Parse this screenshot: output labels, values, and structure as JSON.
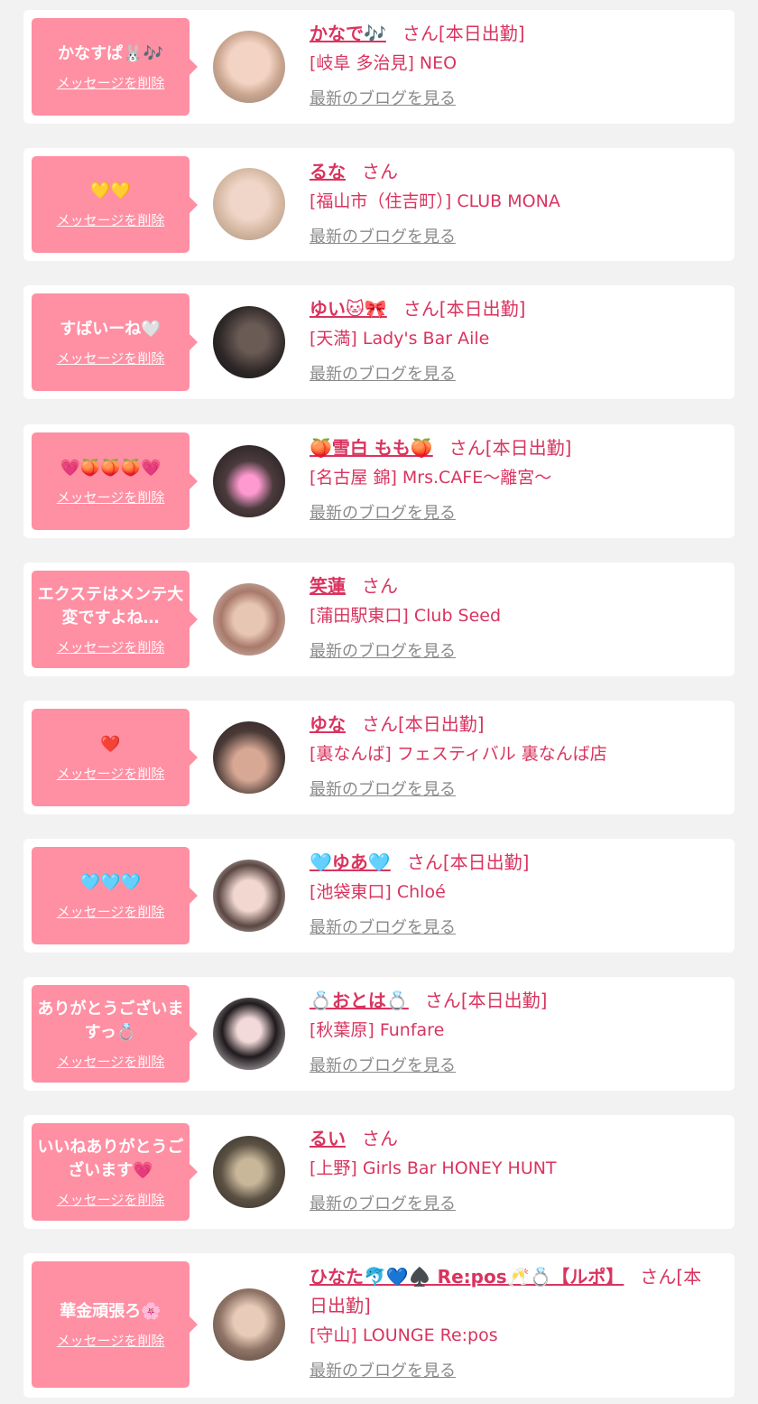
{
  "colors": {
    "accent": "#d9345f",
    "bubble": "#ff8fa3",
    "background": "#f2f2f2",
    "blog_link": "#8a8a8a"
  },
  "labels": {
    "san": "さん",
    "delete": "メッセージを削除",
    "blog": "最新のブログを見る"
  },
  "entries": [
    {
      "message": "かなすぱ🐰🎶",
      "name": "かなで🎶",
      "status": "[本日出勤]",
      "shop": "[岐阜 多治見] NEO"
    },
    {
      "message": "💛💛",
      "name": "るな",
      "status": "",
      "shop": "[福山市（住吉町）] CLUB MONA"
    },
    {
      "message": "すばいーね🤍",
      "name": "ゆい🐱🎀",
      "status": "[本日出勤]",
      "shop": "[天満] Lady's Bar Aile"
    },
    {
      "message": "💗🍑🍑🍑💗",
      "name": "🍑雪白 もも🍑",
      "status": "[本日出勤]",
      "shop": "[名古屋 錦] Mrs.CAFE〜離宮〜"
    },
    {
      "message": "エクステはメンテ大変ですよね…",
      "name": "笑蓮",
      "status": "",
      "shop": "[蒲田駅東口] Club Seed"
    },
    {
      "message": "❤️",
      "name": "ゆな",
      "status": "[本日出勤]",
      "shop": "[裏なんば] フェスティバル 裏なんば店"
    },
    {
      "message": "🩵🩵🩵",
      "name": "🩵ゆあ🩵",
      "status": "[本日出勤]",
      "shop": "[池袋東口] Chloé"
    },
    {
      "message": "ありがとうございますっ💍",
      "name": "💍おとは💍",
      "status": "[本日出勤]",
      "shop": "[秋葉原] Funfare"
    },
    {
      "message": "いいねありがとうございます💗",
      "name": "るい",
      "status": "",
      "shop": "[上野] Girls Bar HONEY HUNT"
    },
    {
      "message": "華金頑張ろ🌸",
      "name": "ひなた🐬💙♠️ Re:pos🥂💍【ルポ】",
      "status": "[本日出勤]",
      "shop": "[守山] LOUNGE Re:pos"
    }
  ]
}
